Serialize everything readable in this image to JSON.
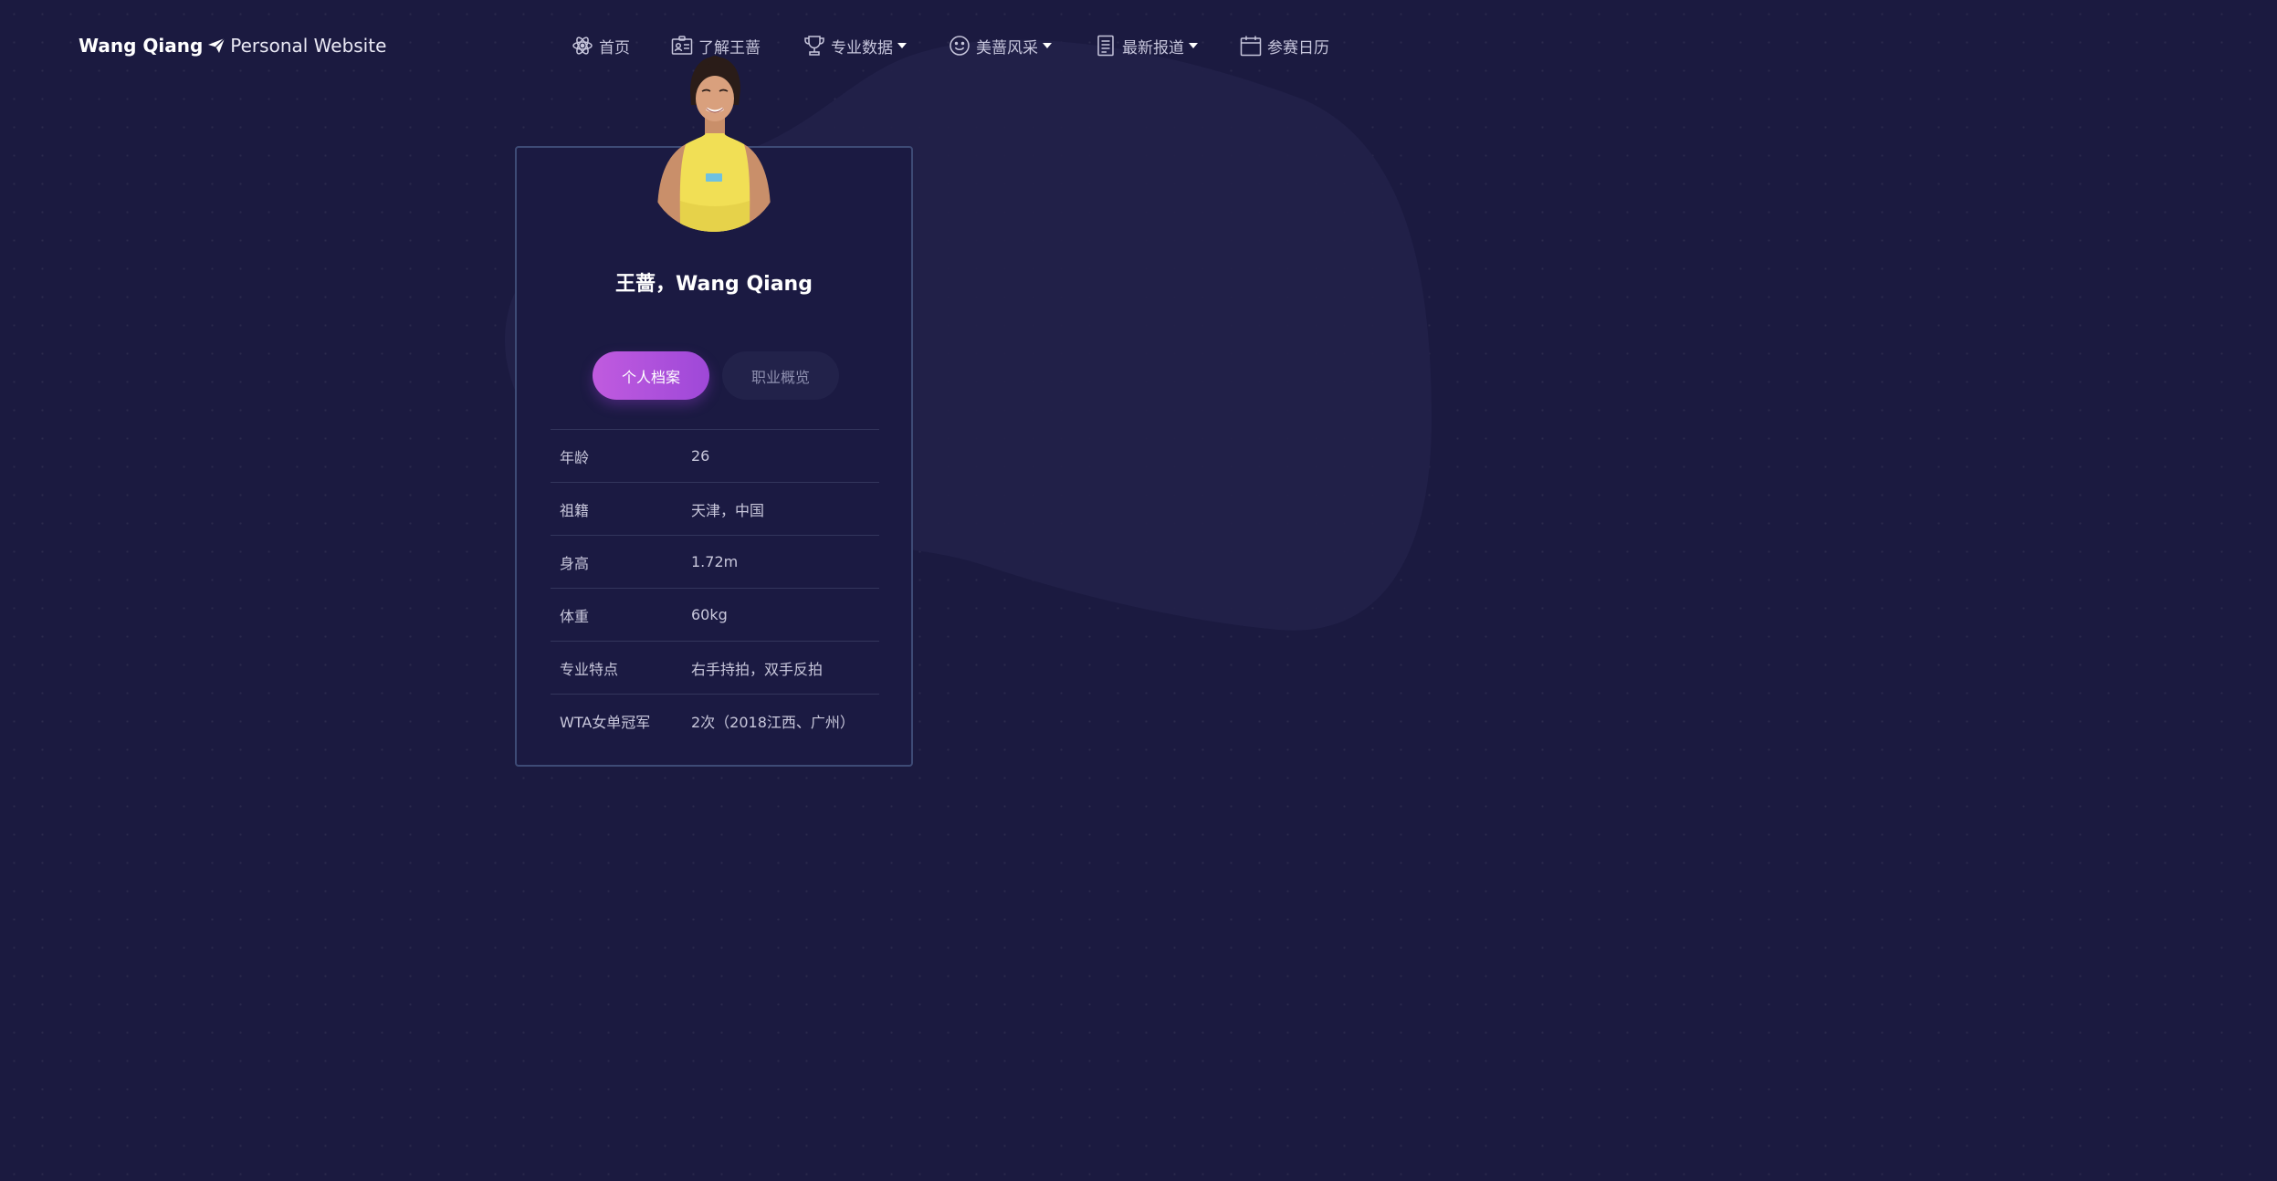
{
  "brand": {
    "name": "Wang Qiang",
    "subtitle": "Personal Website"
  },
  "nav": [
    {
      "label": "首页",
      "icon": "atom-icon",
      "dropdown": false
    },
    {
      "label": "了解王蔷",
      "icon": "id-card-icon",
      "dropdown": false
    },
    {
      "label": "专业数据",
      "icon": "trophy-icon",
      "dropdown": true
    },
    {
      "label": "美蔷风采",
      "icon": "smile-icon",
      "dropdown": true
    },
    {
      "label": "最新报道",
      "icon": "news-icon",
      "dropdown": true
    },
    {
      "label": "参赛日历",
      "icon": "calendar-icon",
      "dropdown": false
    }
  ],
  "profile": {
    "name": "王蔷，Wang Qiang",
    "tabs": [
      "个人档案",
      "职业概览"
    ],
    "active_tab": "个人档案",
    "rows": [
      {
        "label": "年龄",
        "value": "26"
      },
      {
        "label": "祖籍",
        "value": "天津，中国"
      },
      {
        "label": "身高",
        "value": "1.72m"
      },
      {
        "label": "体重",
        "value": "60kg"
      },
      {
        "label": "专业特点",
        "value": "右手持拍，双手反拍"
      },
      {
        "label": "WTA女单冠军",
        "value": "2次（2018江西、广州）"
      }
    ]
  },
  "colors": {
    "background": "#1b1a40",
    "accent_gradient_start": "#c05bdf",
    "accent_gradient_end": "#9e48d8",
    "card_border": "#3e4b76"
  }
}
